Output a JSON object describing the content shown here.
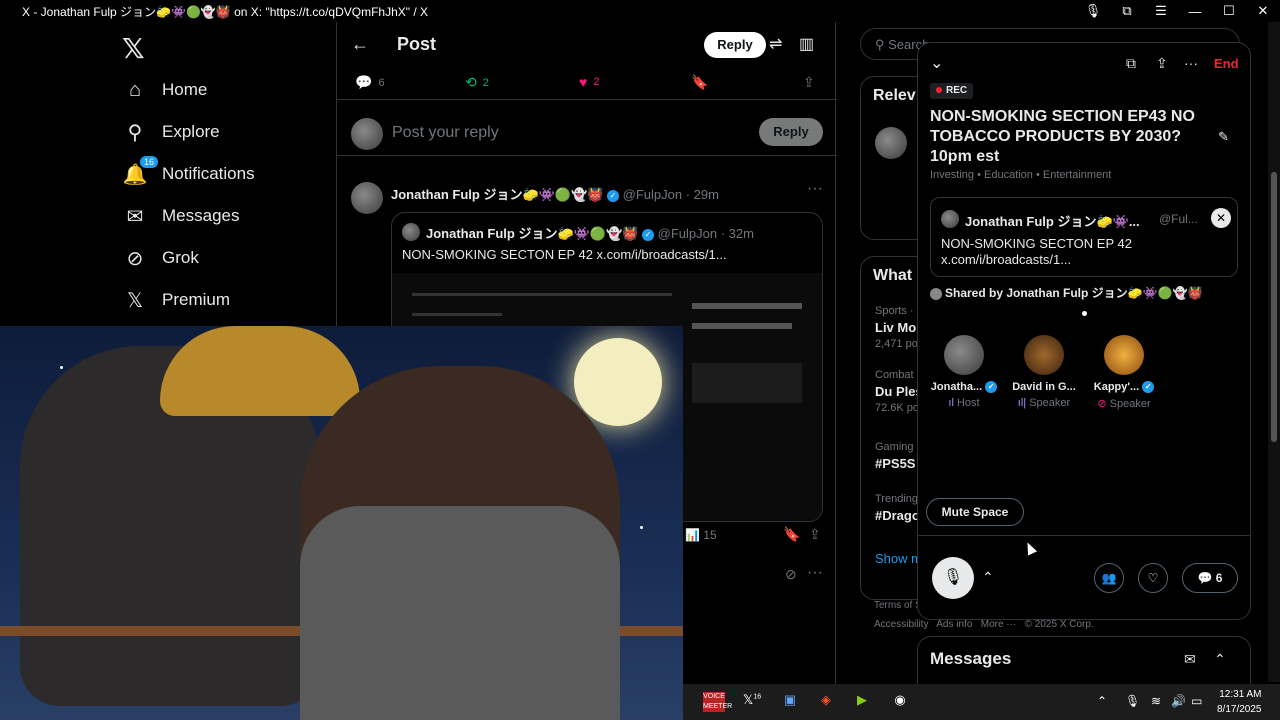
{
  "window": {
    "title": "X - Jonathan Fulp ジョン🧽👾🟢👻👹 on X: \"https://t.co/qDVQmFhJhX\" / X",
    "icons": [
      "mic-icon",
      "extensions-icon",
      "menu-icon",
      "minimize-icon",
      "maximize-icon",
      "close-icon"
    ]
  },
  "nav": {
    "logo": "𝕏",
    "items": [
      {
        "label": "Home",
        "icon": "home-icon",
        "glyph": "⌂"
      },
      {
        "label": "Explore",
        "icon": "search-icon",
        "glyph": "⚲"
      },
      {
        "label": "Notifications",
        "icon": "bell-icon",
        "glyph": "🔔",
        "badge": "16"
      },
      {
        "label": "Messages",
        "icon": "mail-icon",
        "glyph": "✉"
      },
      {
        "label": "Grok",
        "icon": "grok-icon",
        "glyph": "⊘"
      },
      {
        "label": "Premium",
        "icon": "x-icon",
        "glyph": "𝕏"
      }
    ]
  },
  "post": {
    "title": "Post",
    "reply_button": "Reply",
    "stats": {
      "replies": "6",
      "reposts": "2",
      "likes": "2"
    },
    "compose_placeholder": "Post your reply",
    "compose_button": "Reply"
  },
  "tweet": {
    "name": "Jonathan Fulp ジョン🧽👾🟢👻👹",
    "handle": "@FulpJon",
    "time": "· 29m",
    "quote": {
      "name": "Jonathan Fulp ジョン🧽👾🟢👻👹",
      "handle": "@FulpJon",
      "time": "· 32m",
      "text": "NON-SMOKING SECTON EP 42 x.com/i/broadcasts/1..."
    },
    "views": "15"
  },
  "right": {
    "search_placeholder": "Search",
    "relevant_header": "Relev",
    "whats_header": "What",
    "trends": [
      {
        "category": "Sports ·",
        "name": "Liv Mor",
        "count": "2,471 po"
      },
      {
        "category": "Combat",
        "name": "Du Ples",
        "count": "72.6K po"
      },
      {
        "category": "Gaming ·",
        "name": "#PS5S",
        "count": ""
      },
      {
        "category": "Trending",
        "name": "#Drago",
        "count": ""
      }
    ],
    "show_more": "Show m",
    "footer": {
      "terms": "Terms of S",
      "accessibility": "Accessibility",
      "ads": "Ads info",
      "more": "More ···",
      "copyright": "© 2025 X Corp."
    }
  },
  "space": {
    "end_label": "End",
    "rec_label": "REC",
    "title": "NON-SMOKING SECTION EP43 NO TOBACCO PRODUCTS BY 2030? 10pm est",
    "categories": "Investing • Education • Entertainment",
    "pinned": {
      "name": "Jonathan Fulp ジョン🧽👾...",
      "handle": "@Ful...",
      "text_line1": "NON-SMOKING SECTON EP 42",
      "text_line2": "x.com/i/broadcasts/1..."
    },
    "shared_by": "Shared by Jonathan Fulp ジョン🧽👾🟢👻👹",
    "participants": [
      {
        "name": "Jonatha...",
        "role": "Host",
        "color": "#6b6b6b"
      },
      {
        "name": "David in G...",
        "role": "Speaker",
        "color": "#7a4b20"
      },
      {
        "name": "Kappy'...",
        "role": "Speaker",
        "color": "#c7771d"
      }
    ],
    "mute_label": "Mute Space",
    "comments_count": "6"
  },
  "messages_drawer": {
    "title": "Messages"
  },
  "taskbar": {
    "voicemeeter_label": "VOICE MEETER",
    "x_badge": "16",
    "time": "12:31 AM",
    "date": "8/17/2025"
  }
}
